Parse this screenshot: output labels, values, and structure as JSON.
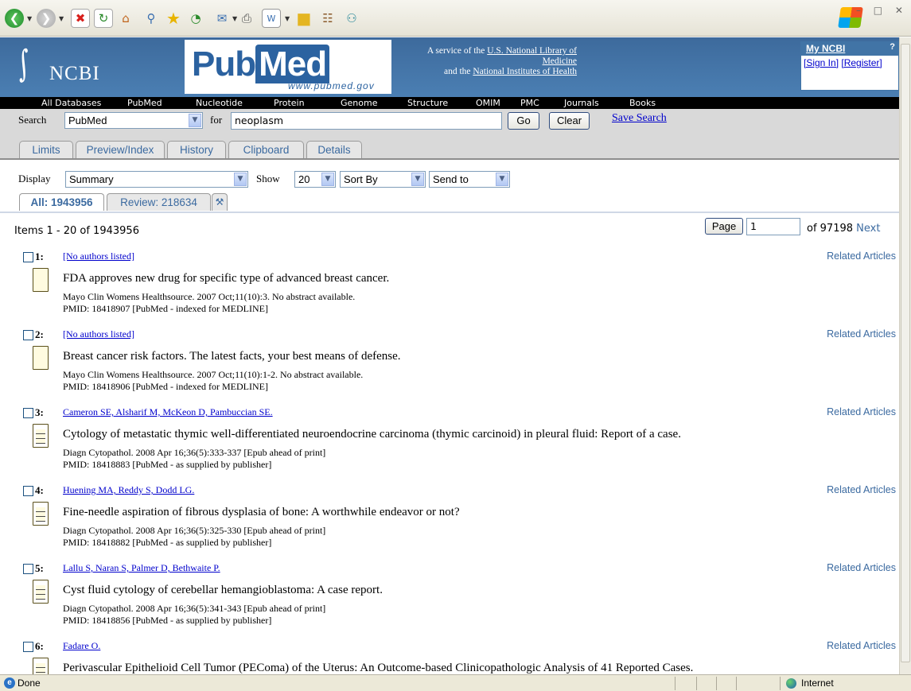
{
  "header": {
    "ncbi_label": "NCBI",
    "pubmed_part1": "Pub",
    "pubmed_part2": "Med",
    "pubmed_url": "www.pubmed.gov",
    "service_line1_prefix": "A service of the ",
    "service_line1_link": "U.S. National Library of Medicine",
    "service_line2_prefix": "and the ",
    "service_line2_link": "National Institutes of Health",
    "myncbi_title": "My NCBI",
    "myncbi_help": "?",
    "sign_in": "[Sign In]",
    "register": "[Register]"
  },
  "nav": [
    "All Databases",
    "PubMed",
    "Nucleotide",
    "Protein",
    "Genome",
    "Structure",
    "OMIM",
    "PMC",
    "Journals",
    "Books"
  ],
  "search": {
    "label": "Search",
    "db_value": "PubMed",
    "for_label": "for",
    "query": "neoplasm",
    "go": "Go",
    "clear": "Clear",
    "save": "Save Search"
  },
  "tabs": [
    "Limits",
    "Preview/Index",
    "History",
    "Clipboard",
    "Details"
  ],
  "display": {
    "label": "Display",
    "value": "Summary",
    "show_label": "Show",
    "show_value": "20",
    "sort_value": "Sort By",
    "send_value": "Send to"
  },
  "result_tabs": {
    "all": "All: 1943956",
    "review": "Review: 218634"
  },
  "pager": {
    "items": "Items 1 - 20 of 1943956",
    "page_button": "Page",
    "page_value": "1",
    "of_text": "of 97198",
    "next": "Next"
  },
  "results": [
    {
      "num": "1:",
      "authors": "[No authors listed]",
      "related": "Related Articles",
      "title": "FDA approves new drug for specific type of advanced breast cancer.",
      "source": "Mayo Clin Womens Healthsource. 2007 Oct;11(10):3. No abstract available.",
      "pmid": "PMID: 18418907 [PubMed - indexed for MEDLINE]"
    },
    {
      "num": "2:",
      "authors": "[No authors listed]",
      "related": "Related Articles",
      "title": "Breast cancer risk factors. The latest facts, your best means of defense.",
      "source": "Mayo Clin Womens Healthsource. 2007 Oct;11(10):1-2. No abstract available.",
      "pmid": "PMID: 18418906 [PubMed - indexed for MEDLINE]"
    },
    {
      "num": "3:",
      "authors": "Cameron SE, Alsharif M, McKeon D, Pambuccian SE.",
      "related": "Related Articles",
      "title": "Cytology of metastatic thymic well-differentiated neuroendocrine carcinoma (thymic carcinoid) in pleural fluid: Report of a case.",
      "source": "Diagn Cytopathol. 2008 Apr 16;36(5):333-337 [Epub ahead of print]",
      "pmid": "PMID: 18418883 [PubMed - as supplied by publisher]"
    },
    {
      "num": "4:",
      "authors": "Huening MA, Reddy S, Dodd LG.",
      "related": "Related Articles",
      "title": "Fine-needle aspiration of fibrous dysplasia of bone: A worthwhile endeavor or not?",
      "source": "Diagn Cytopathol. 2008 Apr 16;36(5):325-330 [Epub ahead of print]",
      "pmid": "PMID: 18418882 [PubMed - as supplied by publisher]"
    },
    {
      "num": "5:",
      "authors": "Lallu S, Naran S, Palmer D, Bethwaite P.",
      "related": "Related Articles",
      "title": "Cyst fluid cytology of cerebellar hemangioblastoma: A case report.",
      "source": "Diagn Cytopathol. 2008 Apr 16;36(5):341-343 [Epub ahead of print]",
      "pmid": "PMID: 18418856 [PubMed - as supplied by publisher]"
    },
    {
      "num": "6:",
      "authors": "Fadare O.",
      "related": "Related Articles",
      "title": "Perivascular Epithelioid Cell Tumor (PEComa) of the Uterus: An Outcome-based Clinicopathologic Analysis of 41 Reported Cases.",
      "source": "",
      "pmid": ""
    }
  ],
  "status": {
    "left": "Done",
    "zone": "Internet"
  },
  "colors": {
    "header_blue": "#4174a6",
    "link_blue": "#0000cc",
    "tab_text": "#3b6aa0"
  }
}
